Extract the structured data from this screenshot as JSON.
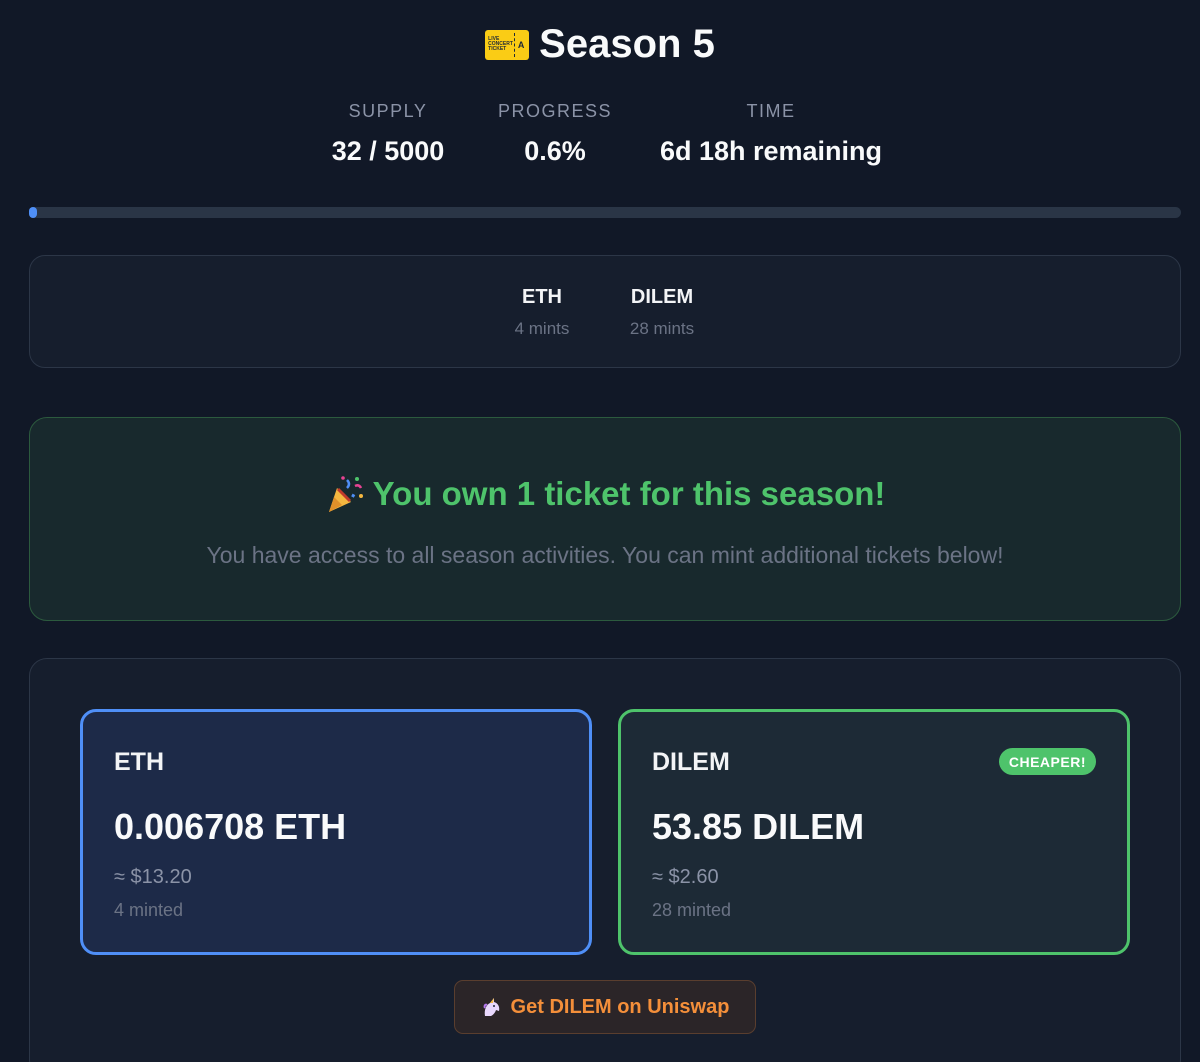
{
  "header": {
    "title": "Season 5",
    "ticket_icon_text": "LIVE CONCERT TICKET"
  },
  "stats": {
    "supply": {
      "label": "SUPPLY",
      "value": "32 / 5000"
    },
    "progress": {
      "label": "PROGRESS",
      "value": "0.6%"
    },
    "time": {
      "label": "TIME",
      "value": "6d 18h remaining"
    }
  },
  "progress_bar": {
    "percent": 0.6,
    "color": "#4f8ff7"
  },
  "breakdown": {
    "items": [
      {
        "name": "ETH",
        "count": "4 mints"
      },
      {
        "name": "DILEM",
        "count": "28 mints"
      }
    ]
  },
  "owned": {
    "title": "You own 1 ticket for this season!",
    "text": "You have access to all season activities. You can mint additional tickets below!",
    "color": "#4ec36b"
  },
  "mint_options": {
    "eth": {
      "name": "ETH",
      "price": "0.006708 ETH",
      "usd": "≈ $13.20",
      "minted": "4 minted",
      "accent": "#4f8ff7"
    },
    "dilem": {
      "name": "DILEM",
      "badge": "CHEAPER!",
      "price": "53.85 DILEM",
      "usd": "≈ $2.60",
      "minted": "28 minted",
      "accent": "#4ec36b"
    }
  },
  "uniswap_button": {
    "label": "Get DILEM on Uniswap",
    "icon": "unicorn-icon",
    "color": "#f48f3a"
  }
}
